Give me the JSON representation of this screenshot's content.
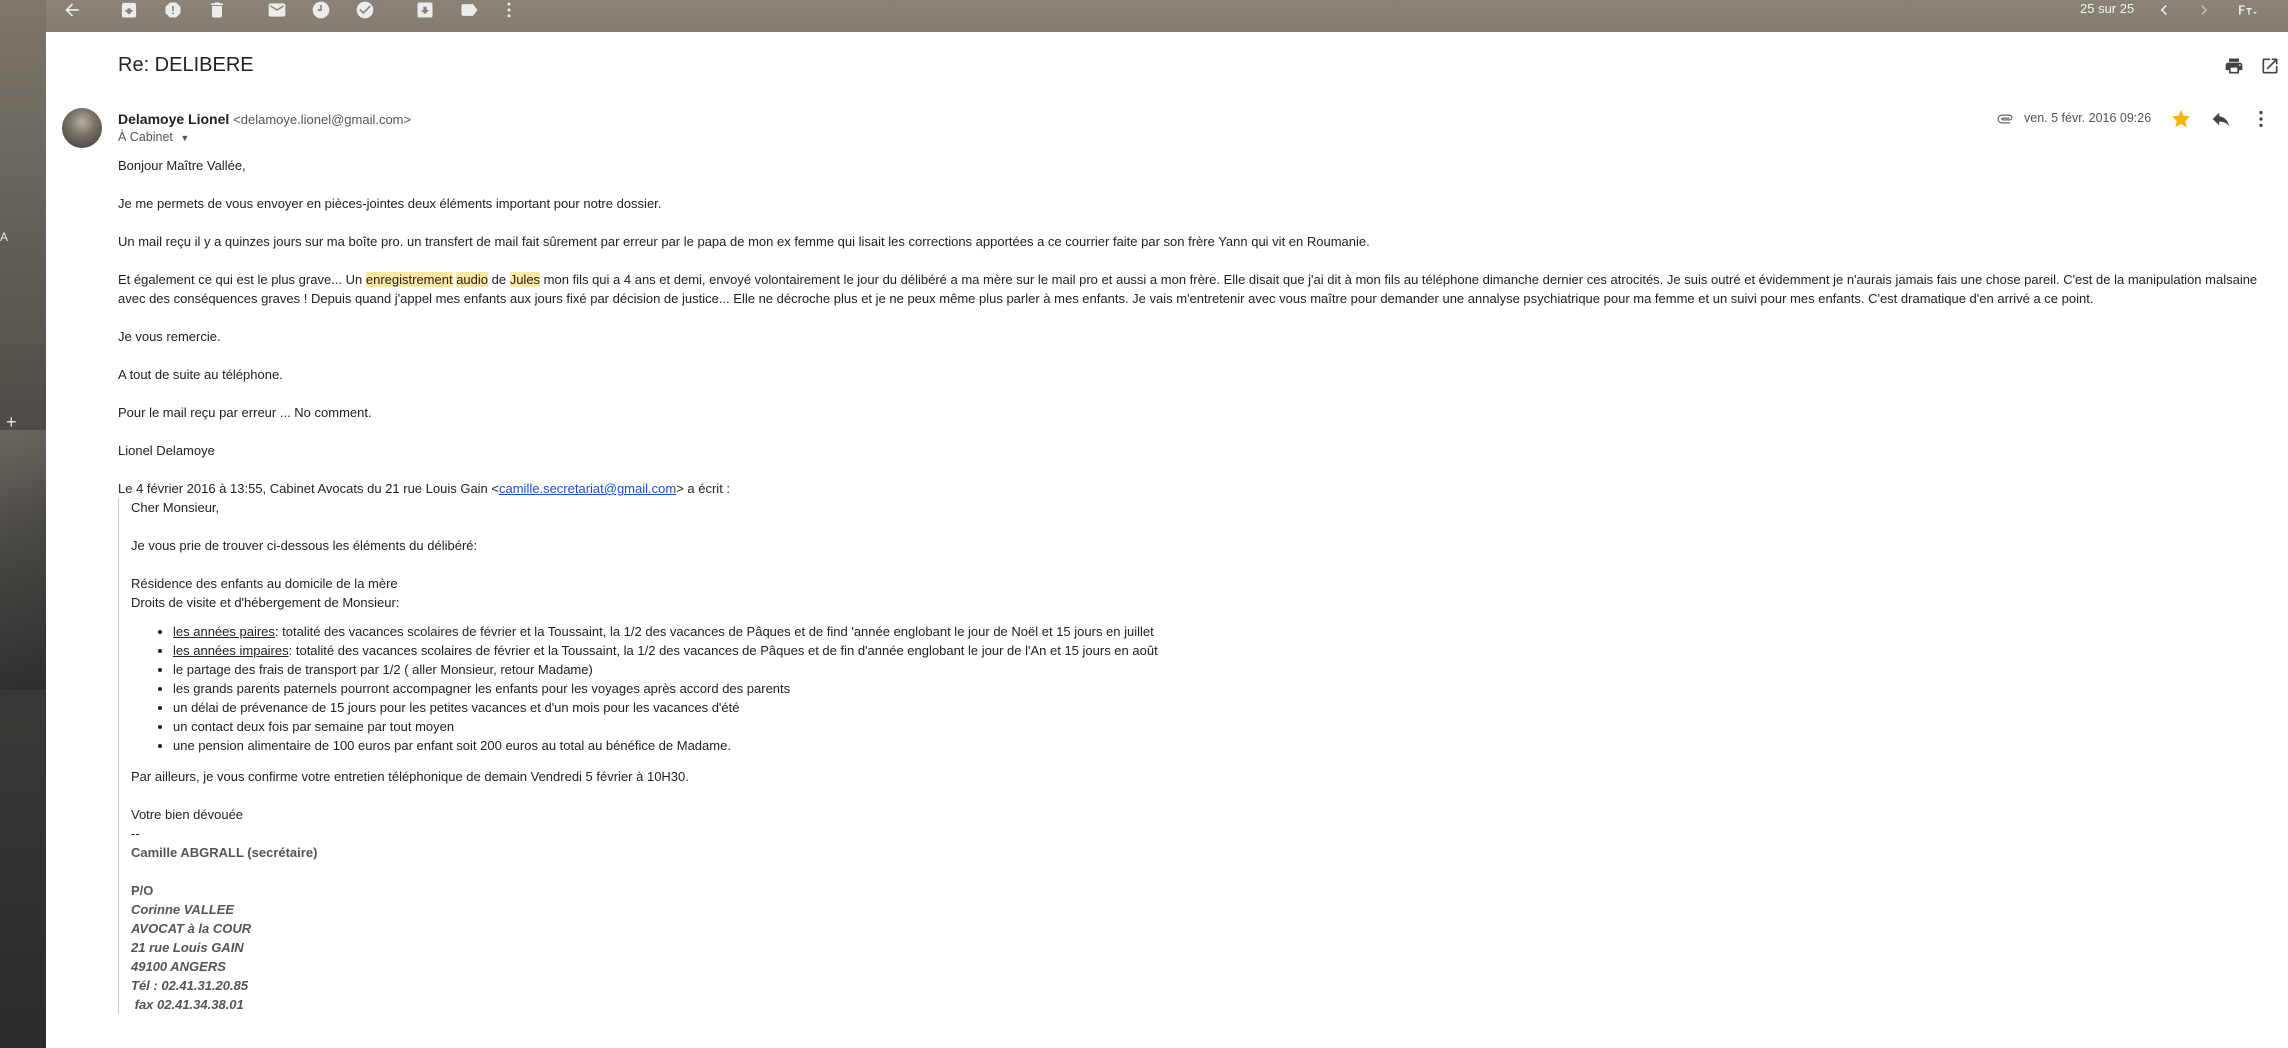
{
  "toolbar": {
    "counter": "25 sur 25"
  },
  "email": {
    "subject": "Re: DELIBERE",
    "sender_name": "Delamoye Lionel",
    "sender_email": "<delamoye.lionel@gmail.com>",
    "to": "À Cabinet",
    "date": "ven. 5 févr. 2016 09:26",
    "greeting": "Bonjour Maître Vallée,",
    "p1": "Je me permets de vous envoyer en pièces-jointes deux éléments important pour notre dossier.",
    "p2": "Un mail reçu il y a quinzes jours sur ma boîte pro. un transfert de mail fait sûrement par erreur par le papa de mon ex femme qui lisait les corrections apportées a ce courrier faite par son frère Yann qui vit en Roumanie.",
    "p3_a": "Et également ce qui est le plus grave... Un ",
    "p3_hl1": "enregistrement",
    "p3_b": " ",
    "p3_hl2": "audio",
    "p3_c": " de ",
    "p3_hl3": "Jules",
    "p3_d": " mon fils qui a 4 ans et demi, envoyé volontairement le jour du délibéré a ma mère sur le mail pro et aussi a mon frère. Elle disait que j'ai dit à mon fils au téléphone dimanche dernier ces atrocités. Je suis outré et évidemment je n'aurais jamais fais une chose pareil. C'est de la manipulation malsaine avec des conséquences graves ! Depuis quand j'appel mes enfants aux jours fixé par décision de justice... Elle ne décroche plus et je ne peux même plus parler à mes enfants. Je vais m'entretenir avec vous maître pour demander une annalyse psychiatrique pour ma femme et un suivi pour mes enfants. C'est dramatique d'en arrivé a ce point.",
    "p4": "Je vous remercie.",
    "p5": "A tout de suite au téléphone.",
    "p6": "Pour le mail reçu par erreur ... No comment.",
    "p7": "Lionel Delamoye",
    "quote_intro_a": "Le 4 février 2016 à 13:55, Cabinet Avocats du 21 rue Louis Gain <",
    "quote_intro_link": "camille.secretariat@gmail.com",
    "quote_intro_b": "> a écrit :",
    "q_greeting": "Cher Monsieur,",
    "q_p1": "Je vous prie de trouver ci-dessous les éléments du délibéré:",
    "q_p2a": "Résidence des enfants au domicile de la mère",
    "q_p2b": "Droits de visite et d'hébergement de Monsieur:",
    "q_list": [
      {
        "u": "les années paires",
        "t": ": totalité des vacances scolaires de février et la Toussaint, la 1/2 des vacances de Pâques et de find 'année englobant le jour de Noël et 15 jours en juillet"
      },
      {
        "u": "les années impaires",
        "t": ":  totalité des vacances scolaires de février et la Toussaint, la 1/2 des vacances de Pâques et de fin d'année englobant le jour de l'An et 15 jours en août"
      },
      {
        "u": "",
        "t": "le partage des frais de transport par 1/2 ( aller Monsieur, retour Madame)"
      },
      {
        "u": "",
        "t": "les grands parents paternels pourront accompagner les enfants pour les voyages après accord des parents"
      },
      {
        "u": "",
        "t": "un délai de prévenance de 15 jours pour les petites vacances et d'un mois pour les vacances d'été"
      },
      {
        "u": "",
        "t": "un contact deux fois par semaine par tout moyen"
      },
      {
        "u": "",
        "t": "une pension alimentaire de 100 euros par enfant soit 200 euros au total au bénéfice de Madame."
      }
    ],
    "q_p3": "Par ailleurs, je vous confirme votre entretien téléphonique de demain Vendredi 5 février à 10H30.",
    "q_close": "Votre bien dévouée",
    "q_dash": "--",
    "q_sig_name": "Camille ABGRALL (secrétaire)",
    "q_po": "P/O",
    "q_sig_lines": [
      "Corinne VALLEE",
      "AVOCAT à la COUR",
      "21 rue Louis GAIN",
      "49100 ANGERS",
      "Tél : 02.41.31.20.85",
      " fax 02.41.34.38.01"
    ]
  },
  "icons": {
    "back": "arrow-left-icon",
    "archive": "archive-icon",
    "spam": "report-spam-icon",
    "delete": "trash-icon",
    "mark_unread": "mail-icon",
    "snooze": "clock-icon",
    "add_task": "task-icon",
    "move": "move-to-icon",
    "label": "label-icon",
    "more": "more-vertical-icon",
    "prev": "chevron-left-icon",
    "next": "chevron-right-icon",
    "input_tools": "keyboard-icon",
    "print": "print-icon",
    "open_new": "open-in-new-icon",
    "attachment": "paperclip-icon",
    "star": "star-icon",
    "reply": "reply-icon"
  },
  "colors": {
    "star": "#f4b400",
    "link": "#1155cc",
    "highlight": "#fce8a1"
  }
}
